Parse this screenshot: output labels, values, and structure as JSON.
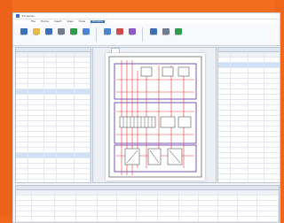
{
  "colors": {
    "brand_orange": "#f0661a",
    "ribbon_blue": "#3b6fb8",
    "wire_red": "#e23b3b",
    "frame_purple": "#5a2ca0",
    "selection": "#cfe0f7"
  },
  "window": {
    "title": "E3.series"
  },
  "menu": {
    "items": [
      "File",
      "Home",
      "Insert",
      "View",
      "Tools",
      "Window"
    ]
  },
  "ribbon": {
    "buttons": [
      {
        "label": "Project",
        "icon": "project-icon",
        "color": "#3b6fb8"
      },
      {
        "label": "Open",
        "icon": "folder-icon",
        "color": "#e6b84a"
      },
      {
        "label": "Save",
        "icon": "save-icon",
        "color": "#3b6fb8"
      },
      {
        "label": "Print",
        "icon": "print-icon",
        "color": "#6f7d8f"
      },
      {
        "label": "Check",
        "icon": "check-icon",
        "color": "#2e9b4f"
      },
      {
        "label": "Sheet",
        "icon": "sheet-icon",
        "color": "#4a86cf"
      },
      {
        "label": "Device",
        "icon": "device-icon",
        "color": "#4a86cf"
      },
      {
        "label": "Wire",
        "icon": "wire-icon",
        "color": "#d04a4a"
      },
      {
        "label": "Cable",
        "icon": "cable-icon",
        "color": "#8c5ac0"
      },
      {
        "label": "Connect",
        "icon": "connect-icon",
        "color": "#3b6fb8"
      },
      {
        "label": "Report",
        "icon": "report-icon",
        "color": "#6f7d8f"
      },
      {
        "label": "Export",
        "icon": "export-icon",
        "color": "#2e9b4f"
      }
    ]
  },
  "left_panel": {
    "header": "",
    "columns": [
      "",
      "",
      "",
      "",
      ""
    ],
    "rows": 28
  },
  "diagram": {
    "tab": "",
    "sheet_type": "schematic"
  },
  "right_panel": {
    "header": "",
    "columns": [
      "",
      "",
      "",
      ""
    ],
    "rows": 28
  },
  "bottom_panel": {
    "header": "",
    "columns": [
      "",
      "",
      "",
      "",
      "",
      "",
      "",
      "",
      "",
      "",
      "",
      "",
      ""
    ],
    "rows": 7
  }
}
